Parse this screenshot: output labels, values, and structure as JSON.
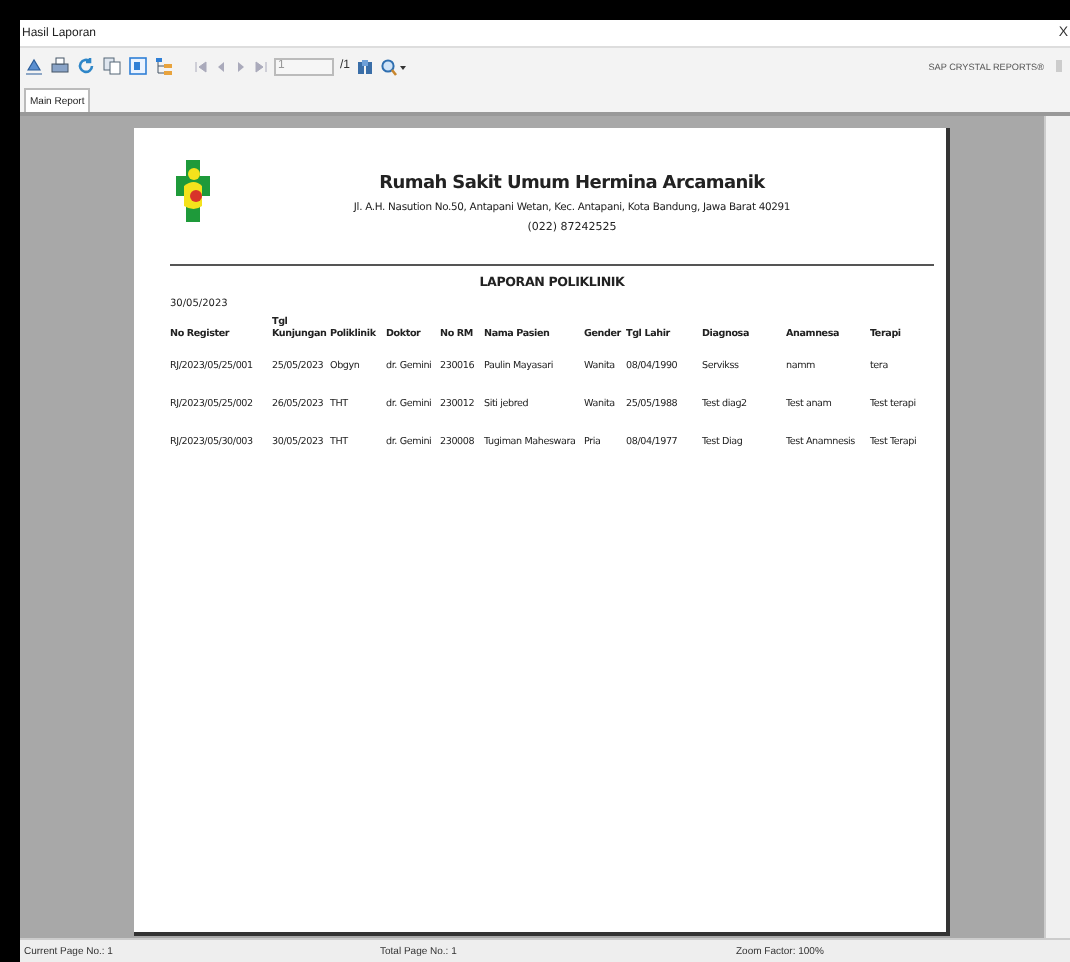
{
  "window": {
    "title": "Hasil Laporan",
    "close": "X"
  },
  "toolbar": {
    "page_field": "1",
    "page_total": "/1",
    "brand": "SAP CRYSTAL REPORTS®"
  },
  "tabs": [
    {
      "label": "Main Report",
      "selected": true
    }
  ],
  "report": {
    "hospital": "Rumah Sakit Umum Hermina Arcamanik",
    "address": "Jl. A.H. Nasution No.50, Antapani Wetan, Kec. Antapani, Kota Bandung, Jawa Barat 40291",
    "phone": "(022) 87242525",
    "title": "LAPORAN POLIKLINIK",
    "date": "30/05/2023",
    "columns": [
      "No Register",
      "Tgl Kunjungan",
      "Poliklinik",
      "Doktor",
      "No RM",
      "Nama Pasien",
      "Gender",
      "Tgl Lahir",
      "Diagnosa",
      "Anamnesa",
      "Terapi"
    ],
    "rows": [
      [
        "RJ/2023/05/25/001",
        "25/05/2023",
        "Obgyn",
        "dr. Gemini",
        "230016",
        "Paulin Mayasari",
        "Wanita",
        "08/04/1990",
        "Servikss",
        "namm",
        "tera"
      ],
      [
        "RJ/2023/05/25/002",
        "26/05/2023",
        "THT",
        "dr. Gemini",
        "230012",
        "Siti jebred",
        "Wanita",
        "25/05/1988",
        "Test diag2",
        "Test anam",
        "Test terapi"
      ],
      [
        "RJ/2023/05/30/003",
        "30/05/2023",
        "THT",
        "dr. Gemini",
        "230008",
        "Tugiman Maheswara",
        "Pria",
        "08/04/1977",
        "Test Diag",
        "Test Anamnesis",
        "Test Terapi"
      ]
    ]
  },
  "status_bar": [
    "Current Page No.: 1",
    "Total Page No.: 1",
    "Zoom Factor: 100%"
  ]
}
